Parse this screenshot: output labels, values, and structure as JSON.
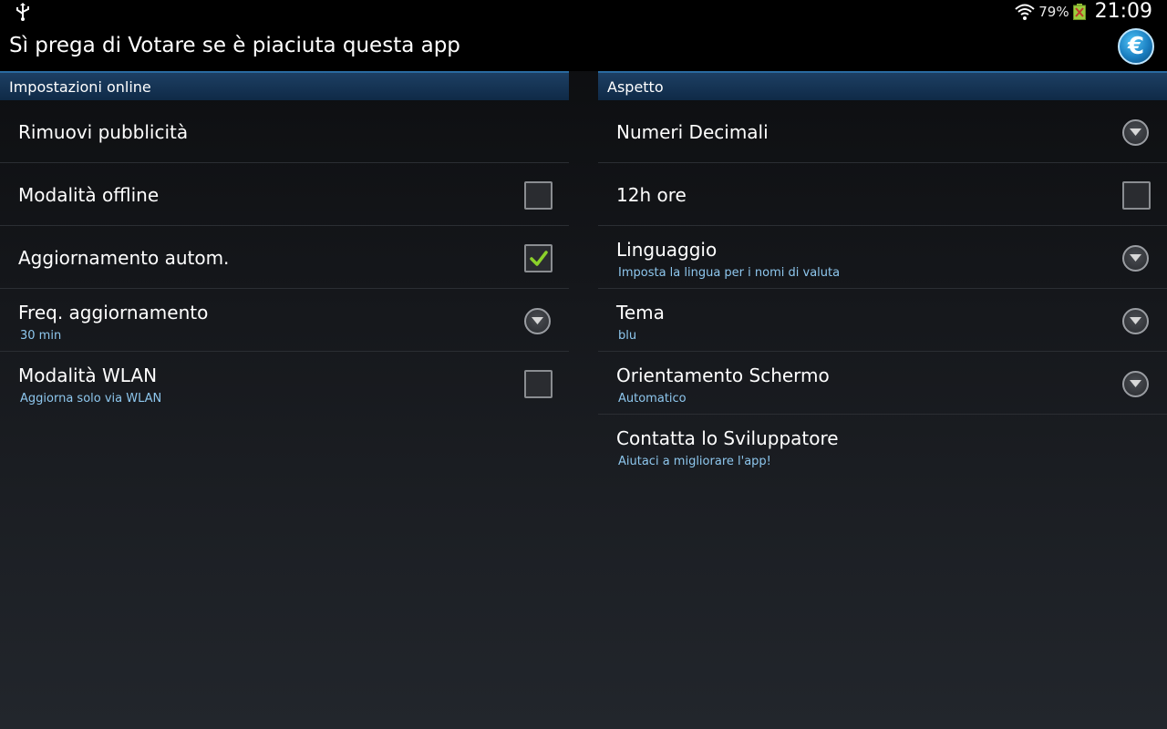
{
  "status_bar": {
    "battery": "79%",
    "time": "21:09",
    "icons": [
      "usb-icon",
      "wifi-icon",
      "battery-icon"
    ]
  },
  "action_bar": {
    "title": "Sì prega di Votare se è piaciuta questa app",
    "logo": "€"
  },
  "left_panel": {
    "header": "Impostazioni online",
    "items": [
      {
        "title": "Rimuovi pubblicità",
        "subtitle": "",
        "control": "none"
      },
      {
        "title": "Modalità offline",
        "subtitle": "",
        "control": "checkbox",
        "checked": false
      },
      {
        "title": "Aggiornamento autom.",
        "subtitle": "",
        "control": "checkbox",
        "checked": true
      },
      {
        "title": "Freq. aggiornamento",
        "subtitle": "30 min",
        "control": "dropdown"
      },
      {
        "title": "Modalità WLAN",
        "subtitle": "Aggiorna solo via WLAN",
        "control": "checkbox",
        "checked": false
      }
    ]
  },
  "right_panel": {
    "header": "Aspetto",
    "items": [
      {
        "title": "Numeri Decimali",
        "subtitle": "",
        "control": "dropdown"
      },
      {
        "title": "12h ore",
        "subtitle": "",
        "control": "checkbox",
        "checked": false
      },
      {
        "title": "Linguaggio",
        "subtitle": "Imposta la lingua per i nomi di valuta",
        "control": "dropdown"
      },
      {
        "title": "Tema",
        "subtitle": "blu",
        "control": "dropdown"
      },
      {
        "title": "Orientamento Schermo",
        "subtitle": "Automatico",
        "control": "dropdown"
      },
      {
        "title": "Contatta lo Sviluppatore",
        "subtitle": "Aiutaci a migliorare l'app!",
        "control": "none"
      }
    ]
  },
  "colors": {
    "accent": "#8ec7ee",
    "header_bg": "#1d3f63",
    "check": "#8bd12a"
  }
}
